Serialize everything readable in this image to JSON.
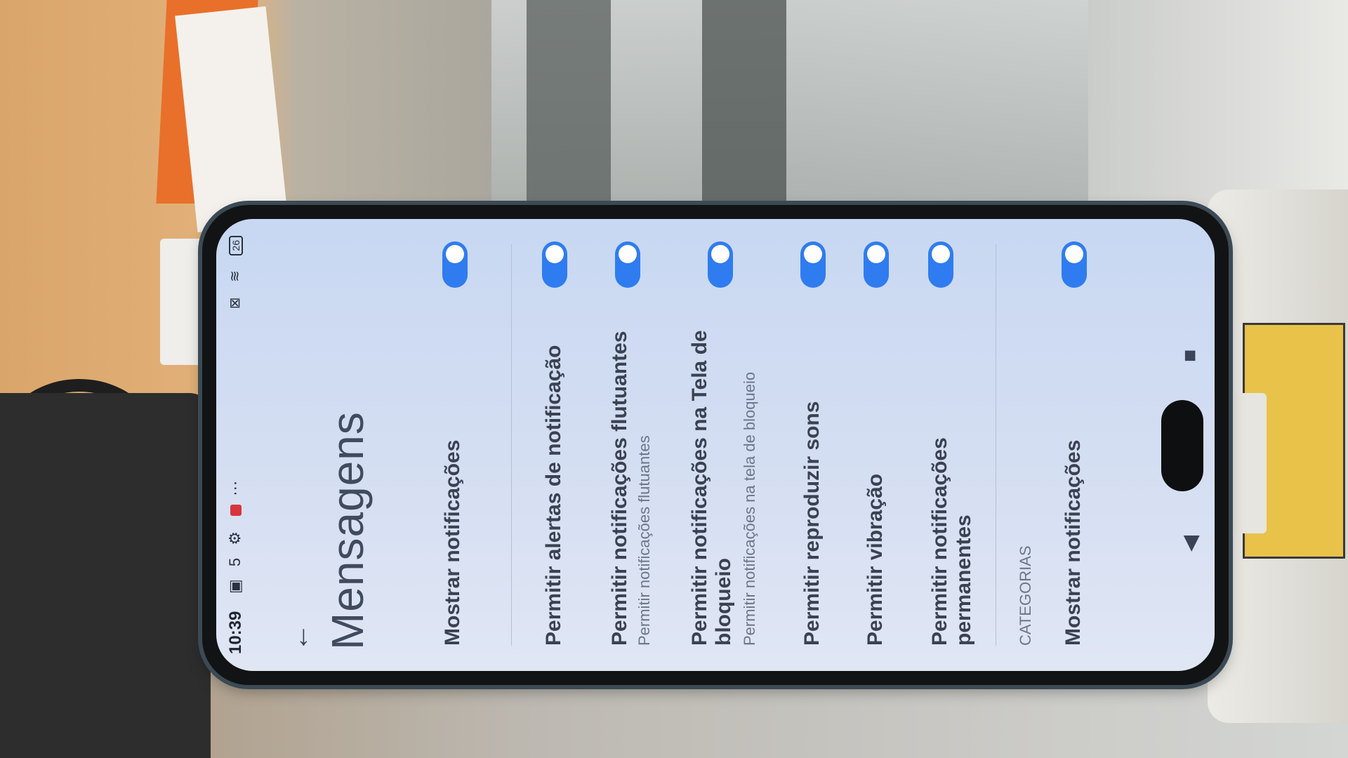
{
  "status_bar": {
    "time": "10:39",
    "icons_left": "▣ 5 ⚙",
    "more": "⋯",
    "icons_right": "⊠ ≋",
    "battery": "26"
  },
  "header": {
    "back_icon": "arrow-left-icon",
    "title": "Mensagens"
  },
  "settings": {
    "show_notifications": "Mostrar notificações",
    "allow_notification_sounds": "Permitir alertas de notificação",
    "floating_notifications": "Permitir notificações flutuantes",
    "floating_notifications_sub": "Permitir notificações flutuantes",
    "lock_screen_notifications": "Permitir notificações na Tela de bloqueio",
    "lock_screen_notifications_sub": "Permitir notificações na tela de bloqueio",
    "allow_sound": "Permitir reproduzir sons",
    "allow_vibration": "Permitir vibração",
    "persistent_notifications": "Permitir notificações permanentes",
    "section_category": "CATEGORIAS",
    "show_notifications_2": "Mostrar notificações"
  },
  "toggles": {
    "show_notifications": true,
    "allow_notification_sounds": true,
    "floating_notifications": true,
    "lock_screen_notifications": true,
    "allow_sound": true,
    "allow_vibration": true,
    "persistent_notifications": true,
    "show_notifications_2": true
  },
  "navbar": {
    "back": "◀",
    "home": "◎",
    "recents": "■"
  },
  "colors": {
    "accent": "#2f7cf0",
    "screen_bg": "#d2ddf2"
  }
}
